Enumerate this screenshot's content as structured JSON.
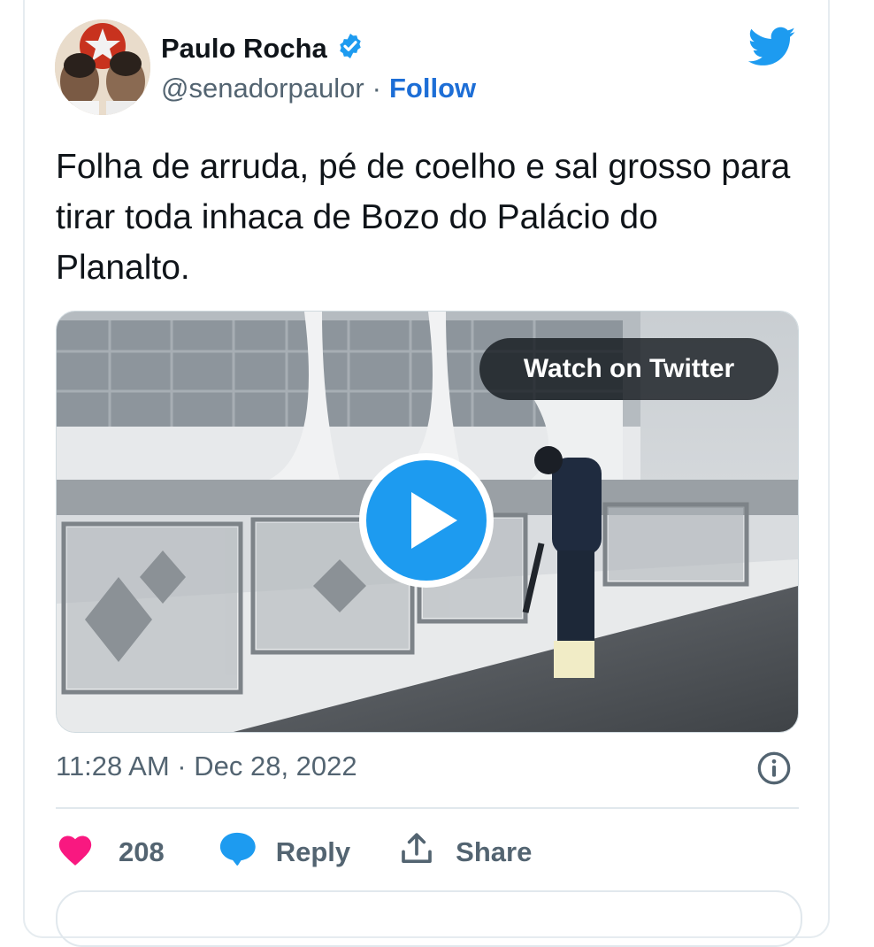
{
  "author": {
    "display_name": "Paulo Rocha",
    "handle": "@senadorpaulor",
    "separator": "·",
    "follow_label": "Follow"
  },
  "tweet": {
    "text": "Folha de arruda, pé de coelho e sal grosso para tirar toda inhaca de Bozo do Palácio do Planalto.",
    "timestamp": "11:28 AM · Dec 28, 2022"
  },
  "media": {
    "watch_label": "Watch on Twitter"
  },
  "actions": {
    "likes_count": "208",
    "reply_label": "Reply",
    "share_label": "Share"
  },
  "colors": {
    "brand": "#1d9bf0",
    "like": "#f91880",
    "link": "#1d6ed6"
  },
  "icons": [
    "twitter-bird-icon",
    "verified-badge-icon",
    "play-icon",
    "info-icon",
    "heart-icon",
    "reply-icon",
    "share-icon"
  ]
}
